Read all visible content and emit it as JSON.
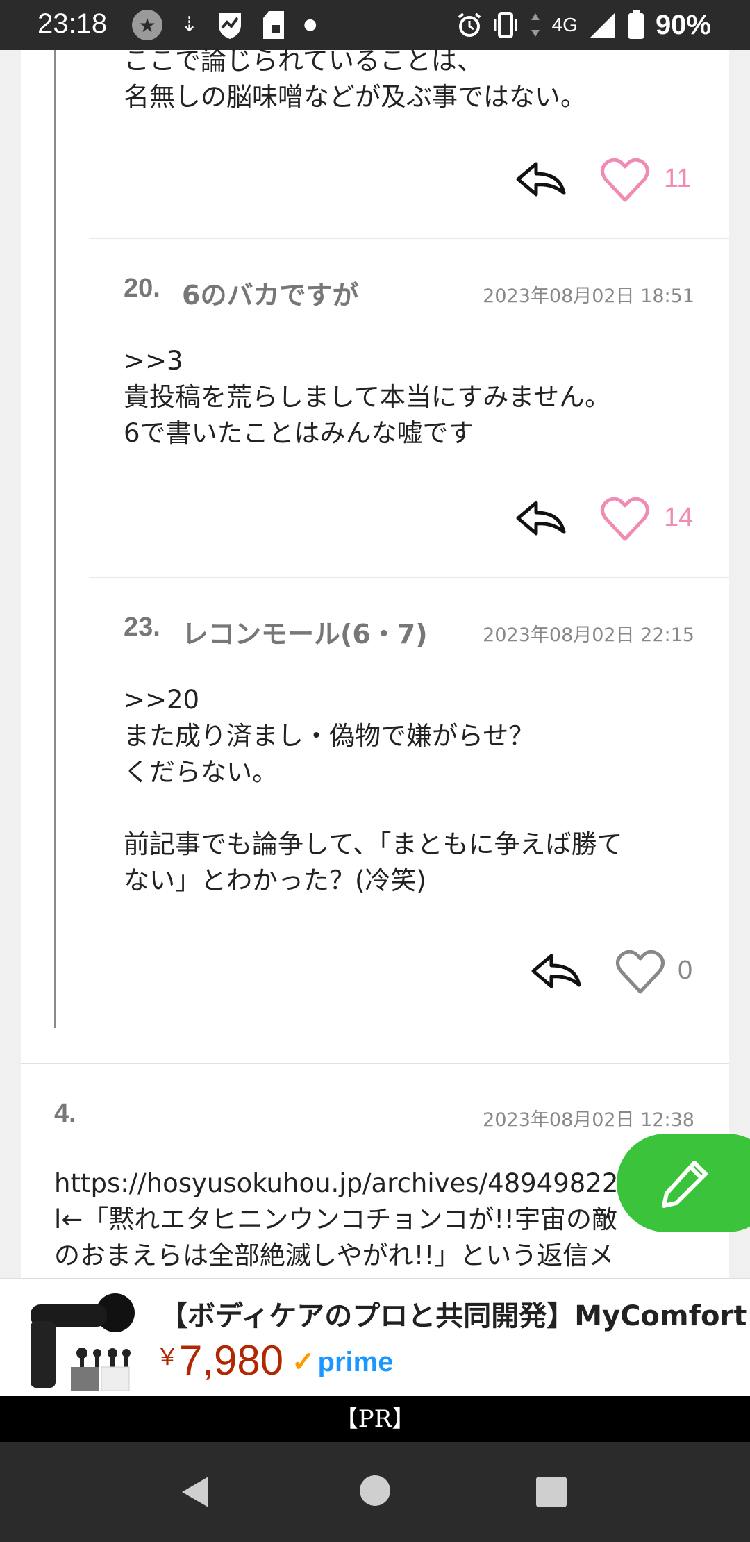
{
  "status_bar": {
    "time": "23:18",
    "network": "4G",
    "battery": "90%",
    "icons_left": [
      "star-circle-icon",
      "usb-icon",
      "shield-chart-icon",
      "sd-card-icon",
      "dot-icon"
    ],
    "icons_right": [
      "alarm-icon",
      "vibrate-icon",
      "data-arrows-icon",
      "signal-icon",
      "battery-icon"
    ]
  },
  "comments": [
    {
      "text": "ここで論じられていることは、\n名無しの脳味噌などが及ぶ事ではない。",
      "likes": "11",
      "liked": true
    },
    {
      "number": "20.",
      "name": "6のバカですが",
      "date": "2023年08月02日 18:51",
      "text": ">>3\n貴投稿を荒らしまして本当にすみません。\n6で書いたことはみんな嘘です",
      "likes": "14",
      "liked": true
    },
    {
      "number": "23.",
      "name": "レコンモール(6・7)",
      "date": "2023年08月02日 22:15",
      "text": ">>20\nまた成り済まし・偽物で嫌がらせ？\nくだらない。\n\n前記事でも論争して、「まともに争えば勝て\nない」とわかった？(冷笑)",
      "likes": "0",
      "liked": false
    }
  ],
  "post4": {
    "number": "4.",
    "date": "2023年08月02日 12:38",
    "text": "https://hosyusokuhou.jp/archives/48949822\nl←「黙れエタヒニンウンコチョンコが!!宇宙の敵\nのおまえらは全部絶滅しやがれ!!」という返信メ"
  },
  "colors": {
    "heart_liked": "#f08cb4",
    "heart_unliked": "#888888",
    "fab": "#3cc33c",
    "price": "#b12704",
    "prime": "#1a98ff"
  },
  "ad": {
    "title": "【ボディケアのプロと共同開発】MyComfort",
    "yen": "￥",
    "price": "7,980",
    "prime": "prime",
    "pr_label": "【PR】"
  },
  "nav": {
    "icons": [
      "back-icon",
      "home-icon",
      "recents-icon"
    ]
  }
}
